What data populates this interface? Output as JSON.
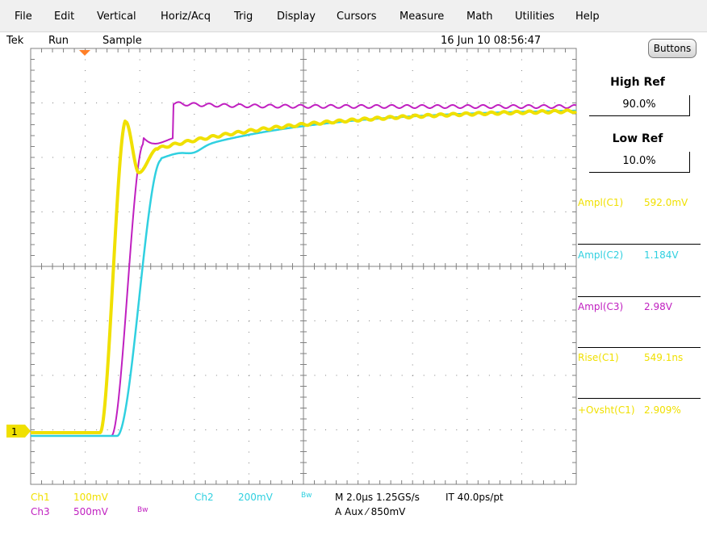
{
  "menu": [
    "File",
    "Edit",
    "Vertical",
    "Horiz/Acq",
    "Trig",
    "Display",
    "Cursors",
    "Measure",
    "Math",
    "Utilities",
    "Help"
  ],
  "status": {
    "brand": "Tek",
    "run": "Run",
    "mode": "Sample",
    "datetime": "16 Jun 10 08:56:47"
  },
  "buttons_label": "Buttons",
  "high_ref": {
    "label": "High Ref",
    "value": "90.0%"
  },
  "low_ref": {
    "label": "Low Ref",
    "value": "10.0%"
  },
  "measurements": [
    {
      "label": "Ampl(C1)",
      "value": "592.0mV",
      "color": "#f0e000"
    },
    {
      "label": "Ampl(C2)",
      "value": "1.184V",
      "color": "#30d0e0"
    },
    {
      "label": "Ampl(C3)",
      "value": "2.98V",
      "color": "#c020c0"
    },
    {
      "label": "Rise(C1)",
      "value": "549.1ns",
      "color": "#f0e000"
    },
    {
      "label": "+Ovsht(C1)",
      "value": "2.909%",
      "color": "#f0e000"
    }
  ],
  "ch1_marker": "1",
  "footer": {
    "ch1": "Ch1",
    "ch1_scale": "100mV",
    "ch2": "Ch2",
    "ch2_scale": "200mV",
    "ch2_bw": "Bw",
    "ch3": "Ch3",
    "ch3_scale": "500mV",
    "ch3_bw": "Bw",
    "timebase": "M 2.0µs 1.25GS/s",
    "interp": "IT 40.0ps/pt",
    "trigger": "A  Aux  ⁄  850mV"
  },
  "colors": {
    "ch1": "#f0e000",
    "ch2": "#30d0e0",
    "ch3": "#c020c0",
    "grid": "#808080",
    "trigger": "#ff7f27"
  }
}
